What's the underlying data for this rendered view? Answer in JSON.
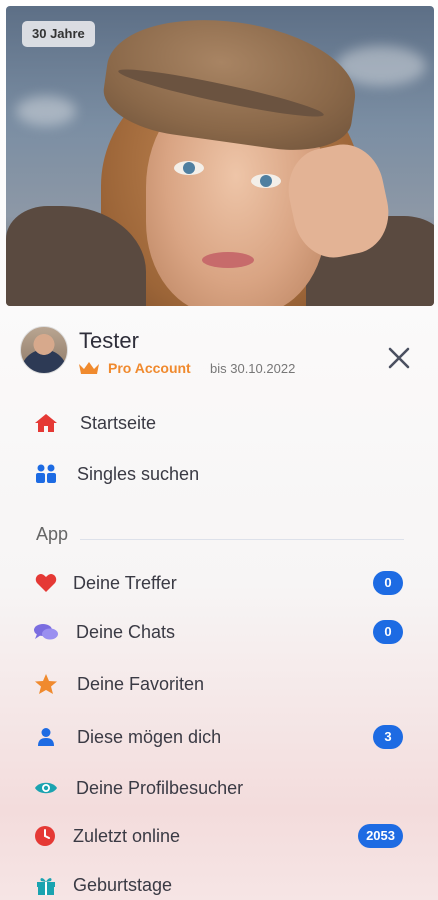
{
  "profile_card": {
    "age_badge": "30 Jahre"
  },
  "user": {
    "name": "Tester",
    "pro_label": "Pro Account",
    "pro_until": "bis 30.10.2022"
  },
  "menu": {
    "main": [
      {
        "label": "Startseite",
        "icon": "home-icon",
        "color": "#e53935"
      },
      {
        "label": "Singles suchen",
        "icon": "people-icon",
        "color": "#1d6be3"
      }
    ],
    "section_title": "App",
    "app": [
      {
        "label": "Deine Treffer",
        "icon": "heart-icon",
        "color": "#e53935",
        "badge": "0"
      },
      {
        "label": "Deine Chats",
        "icon": "chat-icon",
        "color": "#7b6de0",
        "badge": "0"
      },
      {
        "label": "Deine Favoriten",
        "icon": "star-icon",
        "color": "#f08a2e",
        "badge": ""
      },
      {
        "label": "Diese mögen dich",
        "icon": "user-icon",
        "color": "#1d6be3",
        "badge": "3"
      },
      {
        "label": "Deine Profilbesucher",
        "icon": "eye-icon",
        "color": "#1aa3b0",
        "badge": ""
      },
      {
        "label": "Zuletzt online",
        "icon": "clock-icon",
        "color": "#e53935",
        "badge": "2053"
      },
      {
        "label": "Geburtstage",
        "icon": "gift-icon",
        "color": "#1aa3b0",
        "badge": ""
      }
    ]
  },
  "colors": {
    "accent_blue": "#1d6be3",
    "pro_orange": "#f08a2e",
    "red": "#e53935"
  }
}
